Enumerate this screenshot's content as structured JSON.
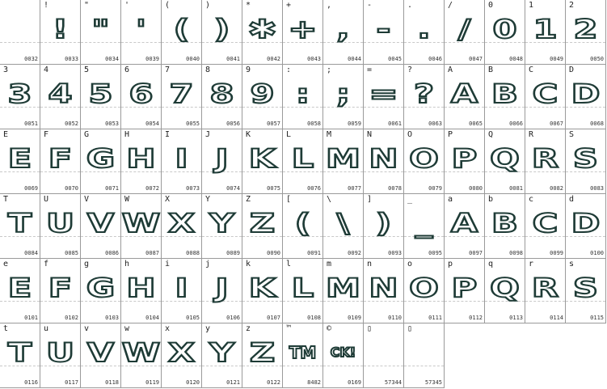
{
  "cells": [
    {
      "ch": "",
      "code": "0032",
      "glyph": ""
    },
    {
      "ch": "!",
      "code": "0033",
      "glyph": "!"
    },
    {
      "ch": "\"",
      "code": "0034",
      "glyph": "\""
    },
    {
      "ch": "'",
      "code": "0039",
      "glyph": "'"
    },
    {
      "ch": "(",
      "code": "0040",
      "glyph": "("
    },
    {
      "ch": ")",
      "code": "0041",
      "glyph": ")"
    },
    {
      "ch": "*",
      "code": "0042",
      "glyph": "✱"
    },
    {
      "ch": "+",
      "code": "0043",
      "glyph": "+"
    },
    {
      "ch": ",",
      "code": "0044",
      "glyph": ","
    },
    {
      "ch": "-",
      "code": "0045",
      "glyph": "-"
    },
    {
      "ch": ".",
      "code": "0046",
      "glyph": "."
    },
    {
      "ch": "/",
      "code": "0047",
      "glyph": "/"
    },
    {
      "ch": "0",
      "code": "0048",
      "glyph": "0"
    },
    {
      "ch": "1",
      "code": "0049",
      "glyph": "1"
    },
    {
      "ch": "2",
      "code": "0050",
      "glyph": "2"
    },
    {
      "ch": "3",
      "code": "0051",
      "glyph": "3"
    },
    {
      "ch": "4",
      "code": "0052",
      "glyph": "4"
    },
    {
      "ch": "5",
      "code": "0053",
      "glyph": "5"
    },
    {
      "ch": "6",
      "code": "0054",
      "glyph": "6"
    },
    {
      "ch": "7",
      "code": "0055",
      "glyph": "7"
    },
    {
      "ch": "8",
      "code": "0056",
      "glyph": "8"
    },
    {
      "ch": "9",
      "code": "0057",
      "glyph": "9"
    },
    {
      "ch": ":",
      "code": "0058",
      "glyph": ":"
    },
    {
      "ch": ";",
      "code": "0059",
      "glyph": ";"
    },
    {
      "ch": "=",
      "code": "0061",
      "glyph": "="
    },
    {
      "ch": "?",
      "code": "0063",
      "glyph": "?"
    },
    {
      "ch": "A",
      "code": "0065",
      "glyph": "A"
    },
    {
      "ch": "B",
      "code": "0066",
      "glyph": "B"
    },
    {
      "ch": "C",
      "code": "0067",
      "glyph": "C"
    },
    {
      "ch": "D",
      "code": "0068",
      "glyph": "D"
    },
    {
      "ch": "E",
      "code": "0069",
      "glyph": "E"
    },
    {
      "ch": "F",
      "code": "0070",
      "glyph": "F"
    },
    {
      "ch": "G",
      "code": "0071",
      "glyph": "G"
    },
    {
      "ch": "H",
      "code": "0072",
      "glyph": "H"
    },
    {
      "ch": "I",
      "code": "0073",
      "glyph": "I"
    },
    {
      "ch": "J",
      "code": "0074",
      "glyph": "J"
    },
    {
      "ch": "K",
      "code": "0075",
      "glyph": "K"
    },
    {
      "ch": "L",
      "code": "0076",
      "glyph": "L"
    },
    {
      "ch": "M",
      "code": "0077",
      "glyph": "M"
    },
    {
      "ch": "N",
      "code": "0078",
      "glyph": "N"
    },
    {
      "ch": "O",
      "code": "0079",
      "glyph": "O"
    },
    {
      "ch": "P",
      "code": "0080",
      "glyph": "P"
    },
    {
      "ch": "Q",
      "code": "0081",
      "glyph": "Q"
    },
    {
      "ch": "R",
      "code": "0082",
      "glyph": "R"
    },
    {
      "ch": "S",
      "code": "0083",
      "glyph": "S"
    },
    {
      "ch": "T",
      "code": "0084",
      "glyph": "T"
    },
    {
      "ch": "U",
      "code": "0085",
      "glyph": "U"
    },
    {
      "ch": "V",
      "code": "0086",
      "glyph": "V"
    },
    {
      "ch": "W",
      "code": "0087",
      "glyph": "W"
    },
    {
      "ch": "X",
      "code": "0088",
      "glyph": "X"
    },
    {
      "ch": "Y",
      "code": "0089",
      "glyph": "Y"
    },
    {
      "ch": "Z",
      "code": "0090",
      "glyph": "Z"
    },
    {
      "ch": "[",
      "code": "0091",
      "glyph": "("
    },
    {
      "ch": "\\",
      "code": "0092",
      "glyph": "\\"
    },
    {
      "ch": "]",
      "code": "0093",
      "glyph": ")"
    },
    {
      "ch": "_",
      "code": "0095",
      "glyph": "_"
    },
    {
      "ch": "a",
      "code": "0097",
      "glyph": "A"
    },
    {
      "ch": "b",
      "code": "0098",
      "glyph": "B"
    },
    {
      "ch": "c",
      "code": "0099",
      "glyph": "C"
    },
    {
      "ch": "d",
      "code": "0100",
      "glyph": "D"
    },
    {
      "ch": "e",
      "code": "0101",
      "glyph": "E"
    },
    {
      "ch": "f",
      "code": "0102",
      "glyph": "F"
    },
    {
      "ch": "g",
      "code": "0103",
      "glyph": "G"
    },
    {
      "ch": "h",
      "code": "0104",
      "glyph": "H"
    },
    {
      "ch": "i",
      "code": "0105",
      "glyph": "I"
    },
    {
      "ch": "j",
      "code": "0106",
      "glyph": "J"
    },
    {
      "ch": "k",
      "code": "0107",
      "glyph": "K"
    },
    {
      "ch": "l",
      "code": "0108",
      "glyph": "L"
    },
    {
      "ch": "m",
      "code": "0109",
      "glyph": "M"
    },
    {
      "ch": "n",
      "code": "0110",
      "glyph": "N"
    },
    {
      "ch": "o",
      "code": "0111",
      "glyph": "O"
    },
    {
      "ch": "p",
      "code": "0112",
      "glyph": "P"
    },
    {
      "ch": "q",
      "code": "0113",
      "glyph": "Q"
    },
    {
      "ch": "r",
      "code": "0114",
      "glyph": "R"
    },
    {
      "ch": "s",
      "code": "0115",
      "glyph": "S"
    },
    {
      "ch": "t",
      "code": "0116",
      "glyph": "T"
    },
    {
      "ch": "u",
      "code": "0117",
      "glyph": "U"
    },
    {
      "ch": "v",
      "code": "0118",
      "glyph": "V"
    },
    {
      "ch": "w",
      "code": "0119",
      "glyph": "W"
    },
    {
      "ch": "x",
      "code": "0120",
      "glyph": "X"
    },
    {
      "ch": "y",
      "code": "0121",
      "glyph": "Y"
    },
    {
      "ch": "z",
      "code": "0122",
      "glyph": "Z"
    },
    {
      "ch": "™",
      "code": "8482",
      "glyph": "TM"
    },
    {
      "ch": "©",
      "code": "0169",
      "glyph": "CK!"
    },
    {
      "ch": "▯",
      "code": "57344",
      "glyph": ""
    },
    {
      "ch": "▯",
      "code": "57345",
      "glyph": ""
    }
  ],
  "colors": {
    "glyph_outline": "#1e3b36",
    "grid_line": "#9a9a9a",
    "baseline": "#c9c9c9"
  }
}
